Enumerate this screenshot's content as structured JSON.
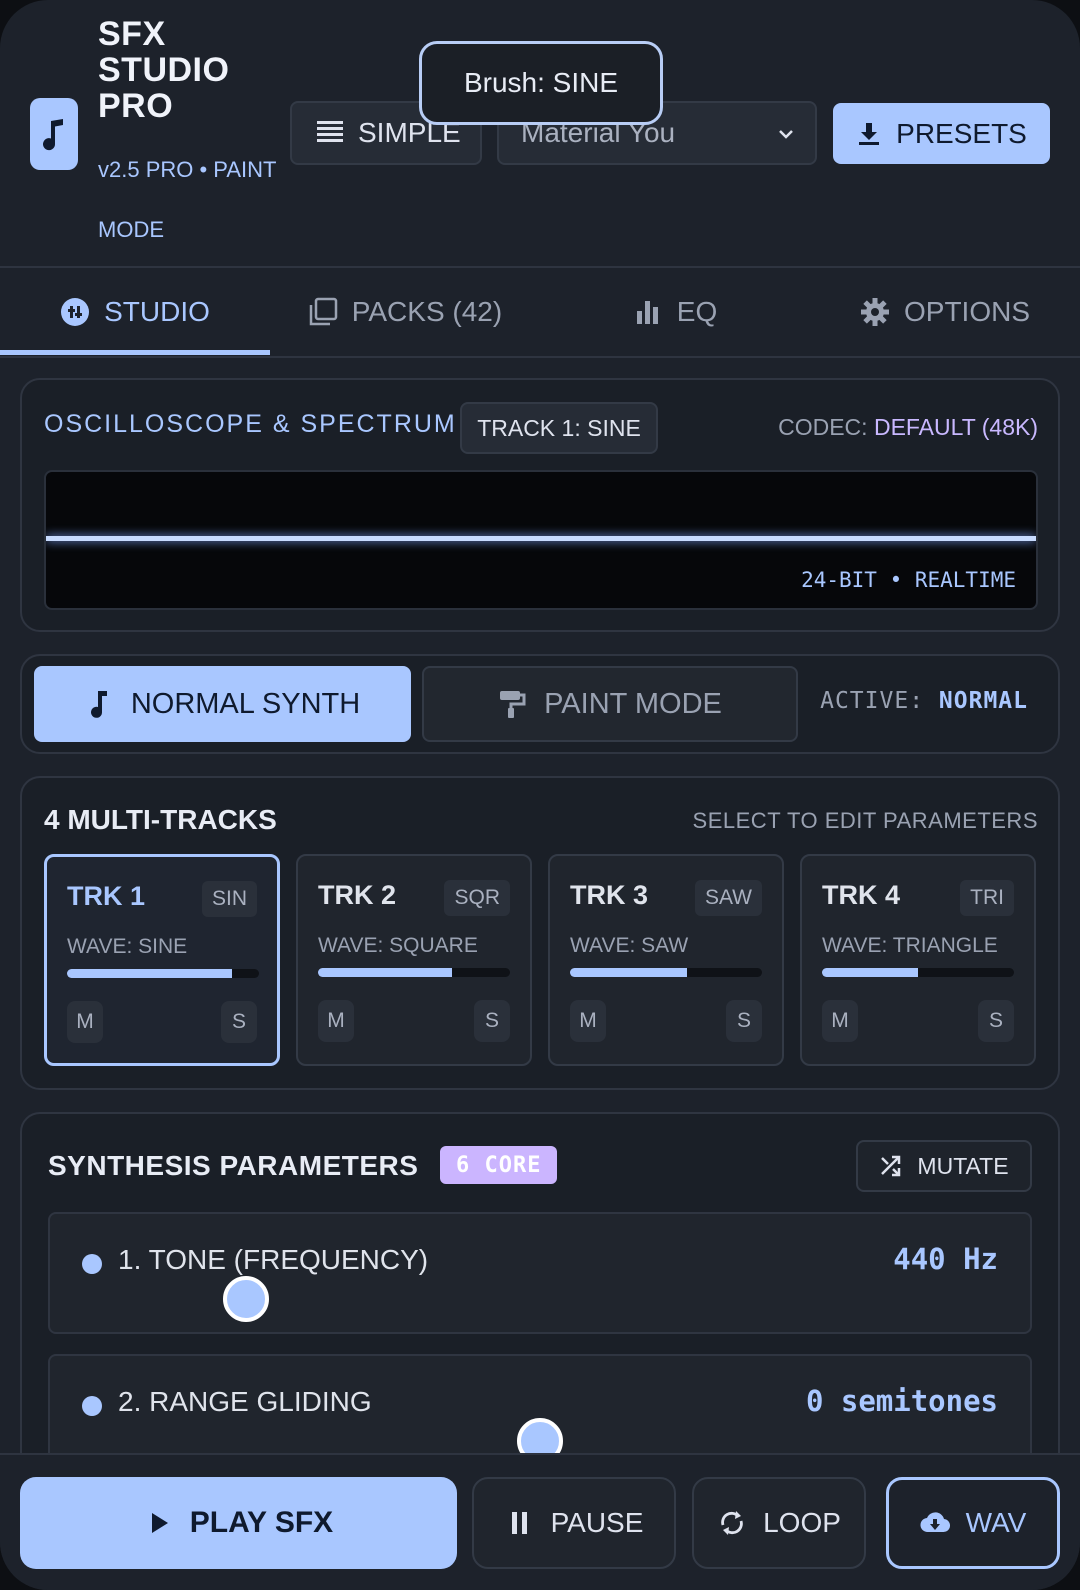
{
  "header": {
    "title": "SFX STUDIO PRO",
    "subtitle": "v2.5 PRO • PAINT MODE",
    "simple_label": "SIMPLE",
    "theme_select": "Material You",
    "presets_label": "PRESETS",
    "tooltip": "Brush: SINE"
  },
  "tabs": [
    {
      "label": "STUDIO",
      "icon": "studio-icon",
      "active": true
    },
    {
      "label": "PACKS (42)",
      "icon": "packs-icon",
      "active": false
    },
    {
      "label": "EQ",
      "icon": "bar-chart-icon",
      "active": false
    },
    {
      "label": "OPTIONS",
      "icon": "gear-icon",
      "active": false
    }
  ],
  "oscilloscope": {
    "title": "OSCILLOSCOPE & SPECTRUM",
    "track_chip": "TRACK 1: SINE",
    "codec_label": "CODEC:",
    "codec_value": "DEFAULT (48K)",
    "status": "24-BIT • REALTIME"
  },
  "mode": {
    "normal_label": "NORMAL SYNTH",
    "paint_label": "PAINT MODE",
    "active_label": "ACTIVE:",
    "active_value": "NORMAL"
  },
  "multitracks": {
    "title": "4 MULTI-TRACKS",
    "hint": "SELECT TO EDIT PARAMETERS",
    "tracks": [
      {
        "name": "TRK 1",
        "badge": "SIN",
        "wave": "WAVE: SINE",
        "level": 0.86,
        "m": "M",
        "s": "S",
        "selected": true
      },
      {
        "name": "TRK 2",
        "badge": "SQR",
        "wave": "WAVE: SQUARE",
        "level": 0.7,
        "m": "M",
        "s": "S",
        "selected": false
      },
      {
        "name": "TRK 3",
        "badge": "SAW",
        "wave": "WAVE: SAW",
        "level": 0.61,
        "m": "M",
        "s": "S",
        "selected": false
      },
      {
        "name": "TRK 4",
        "badge": "TRI",
        "wave": "WAVE: TRIANGLE",
        "level": 0.5,
        "m": "M",
        "s": "S",
        "selected": false
      }
    ]
  },
  "synthesis": {
    "title": "SYNTHESIS PARAMETERS",
    "badge": "6 CORE",
    "mutate_label": "MUTATE",
    "params": [
      {
        "label": "1. TONE (FREQUENCY)",
        "value": "440 Hz",
        "slider": 0.2
      },
      {
        "label": "2. RANGE GLIDING",
        "value": "0 semitones",
        "slider": 0.5
      }
    ]
  },
  "bottom": {
    "play_label": "PLAY SFX",
    "pause_label": "PAUSE",
    "loop_label": "LOOP",
    "wav_label": "WAV"
  },
  "colors": {
    "accent": "#a9c7ff",
    "badge": "#cbb5ff",
    "background": "#1d222b"
  }
}
